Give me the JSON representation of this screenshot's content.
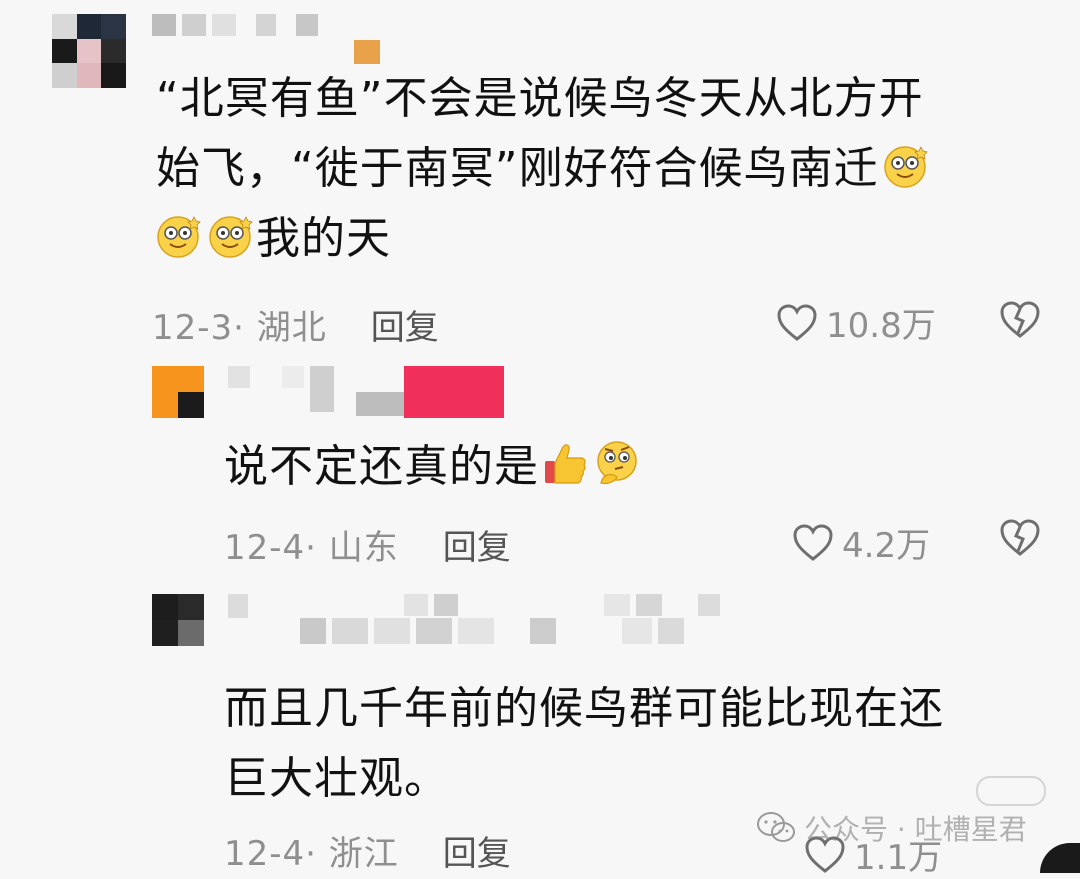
{
  "comments": [
    {
      "line1": "“北冥有鱼”不会是说候鸟冬天从北方开",
      "line2": "始飞，“徙于南冥”刚好符合候鸟南迁",
      "line3": "我的天",
      "emoji_names": [
        "dizzy-smile-emoji",
        "dizzy-smile-emoji",
        "dizzy-smile-emoji"
      ],
      "date_location": "12-3· 湖北",
      "reply_label": "回复",
      "like_count": "10.8万"
    },
    {
      "line1": "说不定还真的是",
      "emoji_names": [
        "thumbs-up-emoji",
        "thinking-face-emoji"
      ],
      "date_location": "12-4· 山东",
      "reply_label": "回复",
      "like_count": "4.2万"
    },
    {
      "line1": "而且几千年前的候鸟群可能比现在还",
      "line2": "巨大壮观。",
      "date_location": "12-4· 浙江",
      "reply_label": "回复",
      "like_count": "1.1万"
    }
  ],
  "watermark": {
    "text": "公众号 · 吐槽星君",
    "icon": "wechat-icon"
  },
  "icons": {
    "like": "heart-outline-icon",
    "dislike": "broken-heart-icon"
  },
  "colors": {
    "background": "#f7f7f7",
    "text": "#111111",
    "meta": "#8f8f8f",
    "name_badge": "#f0305a",
    "avatar_orange": "#f7941d"
  }
}
